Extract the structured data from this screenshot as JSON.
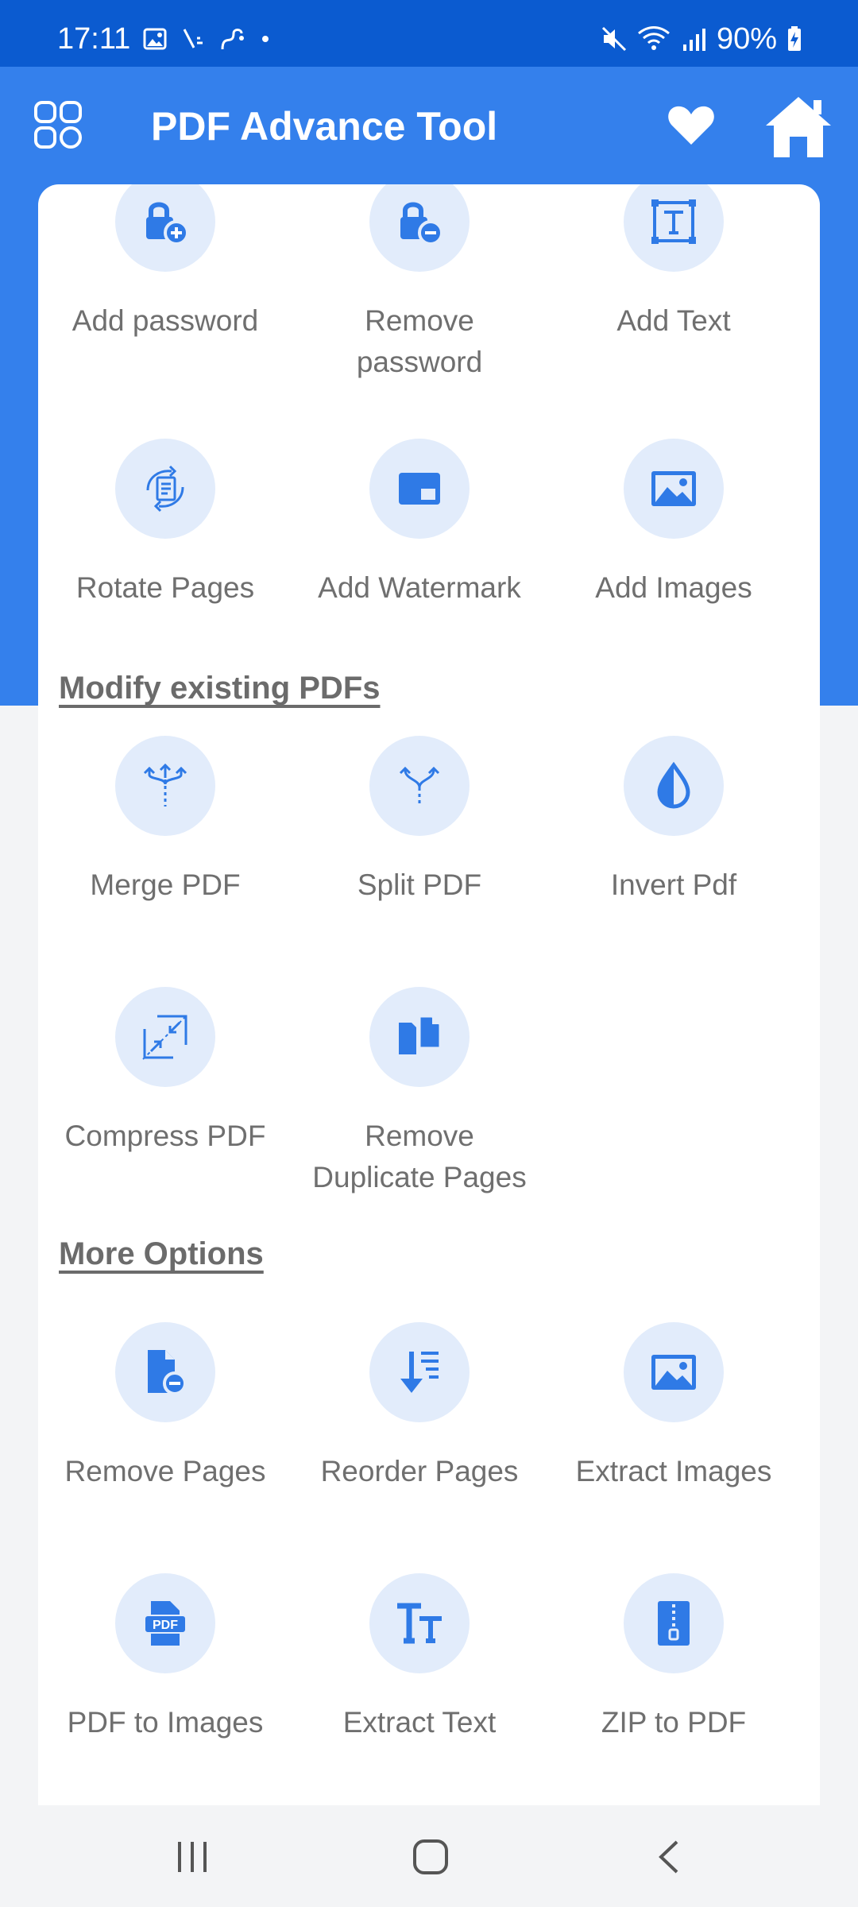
{
  "status": {
    "time": "17:11",
    "battery": "90%"
  },
  "appbar": {
    "title": "PDF Advance Tool",
    "icons": [
      "grid-menu-icon",
      "heart-icon",
      "home-icon"
    ]
  },
  "colors": {
    "status_bar": "#0b5bd0",
    "app_bar": "#3480ec",
    "icon_circle": "#e2ecfb",
    "icon": "#2f7ae6",
    "label": "#6f6f6f"
  },
  "sections": {
    "create": {
      "items": [
        {
          "label": "Add password",
          "icon": "lock-plus-icon"
        },
        {
          "label": "Remove password",
          "icon": "lock-minus-icon"
        },
        {
          "label": "Add Text",
          "icon": "text-box-icon"
        },
        {
          "label": "Rotate Pages",
          "icon": "rotate-page-icon"
        },
        {
          "label": "Add Watermark",
          "icon": "watermark-icon"
        },
        {
          "label": "Add Images",
          "icon": "image-icon"
        }
      ]
    },
    "modify": {
      "title": "Modify existing PDFs",
      "items": [
        {
          "label": "Merge PDF",
          "icon": "merge-icon"
        },
        {
          "label": "Split PDF",
          "icon": "split-icon"
        },
        {
          "label": "Invert Pdf",
          "icon": "invert-drop-icon"
        },
        {
          "label": "Compress PDF",
          "icon": "compress-icon"
        },
        {
          "label": "Remove Duplicate Pages",
          "icon": "duplicate-pages-icon"
        }
      ]
    },
    "more": {
      "title": "More Options",
      "items": [
        {
          "label": "Remove Pages",
          "icon": "file-minus-icon"
        },
        {
          "label": "Reorder Pages",
          "icon": "reorder-icon"
        },
        {
          "label": "Extract Images",
          "icon": "image-icon"
        },
        {
          "label": "PDF to Images",
          "icon": "pdf-file-icon"
        },
        {
          "label": "Extract Text",
          "icon": "text-format-icon"
        },
        {
          "label": "ZIP to PDF",
          "icon": "zip-icon"
        }
      ]
    }
  },
  "navbar": {
    "icons": [
      "recent-apps-icon",
      "home-circle-icon",
      "back-icon"
    ]
  }
}
